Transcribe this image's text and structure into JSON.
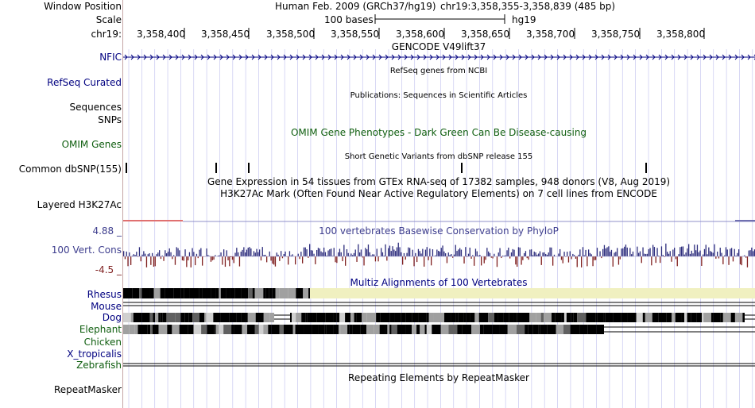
{
  "header": {
    "window_position_label": "Window Position",
    "window_position_value": "Human Feb. 2009 (GRCh37/hg19)",
    "window_position_coords": "chr19:3,358,355-3,358,839 (485 bp)",
    "scale_label": "Scale",
    "scale_bar_text": "100 bases",
    "scale_assembly": "hg19",
    "chrom_label": "chr19:",
    "positions": [
      "3,358,400",
      "3,358,450",
      "3,358,500",
      "3,358,550",
      "3,358,600",
      "3,358,650",
      "3,358,700",
      "3,358,750",
      "3,358,800"
    ]
  },
  "tracks": {
    "gencode_title": "GENCODE V49lift37",
    "nfic_label": "NFIC",
    "refseq_label": "RefSeq Curated",
    "refseq_title": "RefSeq genes from NCBI",
    "sequences_label": "Sequences",
    "publications_title": "Publications: Sequences in Scientific Articles",
    "snps_label": "SNPs",
    "omim_label": "OMIM Genes",
    "omim_title": "OMIM Gene Phenotypes - Dark Green Can Be Disease-causing",
    "dbsnp_title": "Short Genetic Variants from dbSNP release 155",
    "dbsnp_label": "Common dbSNP(155)",
    "gtex_title": "Gene Expression in 54 tissues from GTEx RNA-seq of 17382 samples, 948 donors (V8, Aug 2019)",
    "h3k_title": "H3K27Ac Mark (Often Found Near Active Regulatory Elements) on 7 cell lines from ENCODE",
    "h3k_label": "Layered H3K27Ac",
    "cons_max": "4.88 _",
    "cons_title": "100 vertebrates Basewise Conservation by PhyloP",
    "cons_label": "100 Vert. Cons",
    "cons_min": "-4.5 _",
    "multiz_title": "Multiz Alignments of 100 Vertebrates",
    "species": [
      "Rhesus",
      "Mouse",
      "Dog",
      "Elephant",
      "Chicken",
      "X_tropicalis",
      "Zebrafish"
    ],
    "repeat_title": "Repeating Elements by RepeatMasker",
    "repeat_label": "RepeatMasker"
  },
  "colors": {
    "gene_blue": "#000080",
    "omim_green": "#0f5e0f",
    "cons_pos": "#2d2d7d",
    "cons_neg": "#7f1f1f",
    "multiz_gap": "#f0f0c0",
    "grid": "#c8c8f0"
  }
}
